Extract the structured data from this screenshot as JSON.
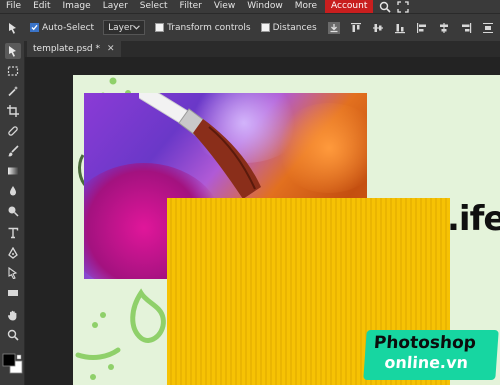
{
  "menu": {
    "items": [
      "File",
      "Edit",
      "Image",
      "Layer",
      "Select",
      "Filter",
      "View",
      "Window",
      "More"
    ],
    "account": "Account"
  },
  "options": {
    "auto_select_label": "Auto-Select",
    "auto_select_checked": true,
    "target_value": "Layer",
    "transform_controls_label": "Transform controls",
    "transform_controls_checked": false,
    "distances_label": "Distances",
    "distances_checked": false
  },
  "tab": {
    "title": "template.psd *",
    "close_glyph": "✕"
  },
  "canvas": {
    "headline_fragment": ".ife",
    "badge_line1": "Photoshop",
    "badge_line2": "online.vn"
  },
  "colors": {
    "accent_account": "#c81e1e",
    "doc_background": "#e4f3da",
    "yellow_card": "#f6c204",
    "badge": "#17d6a1",
    "foreground_color": "#000000",
    "background_color": "#ffffff"
  }
}
